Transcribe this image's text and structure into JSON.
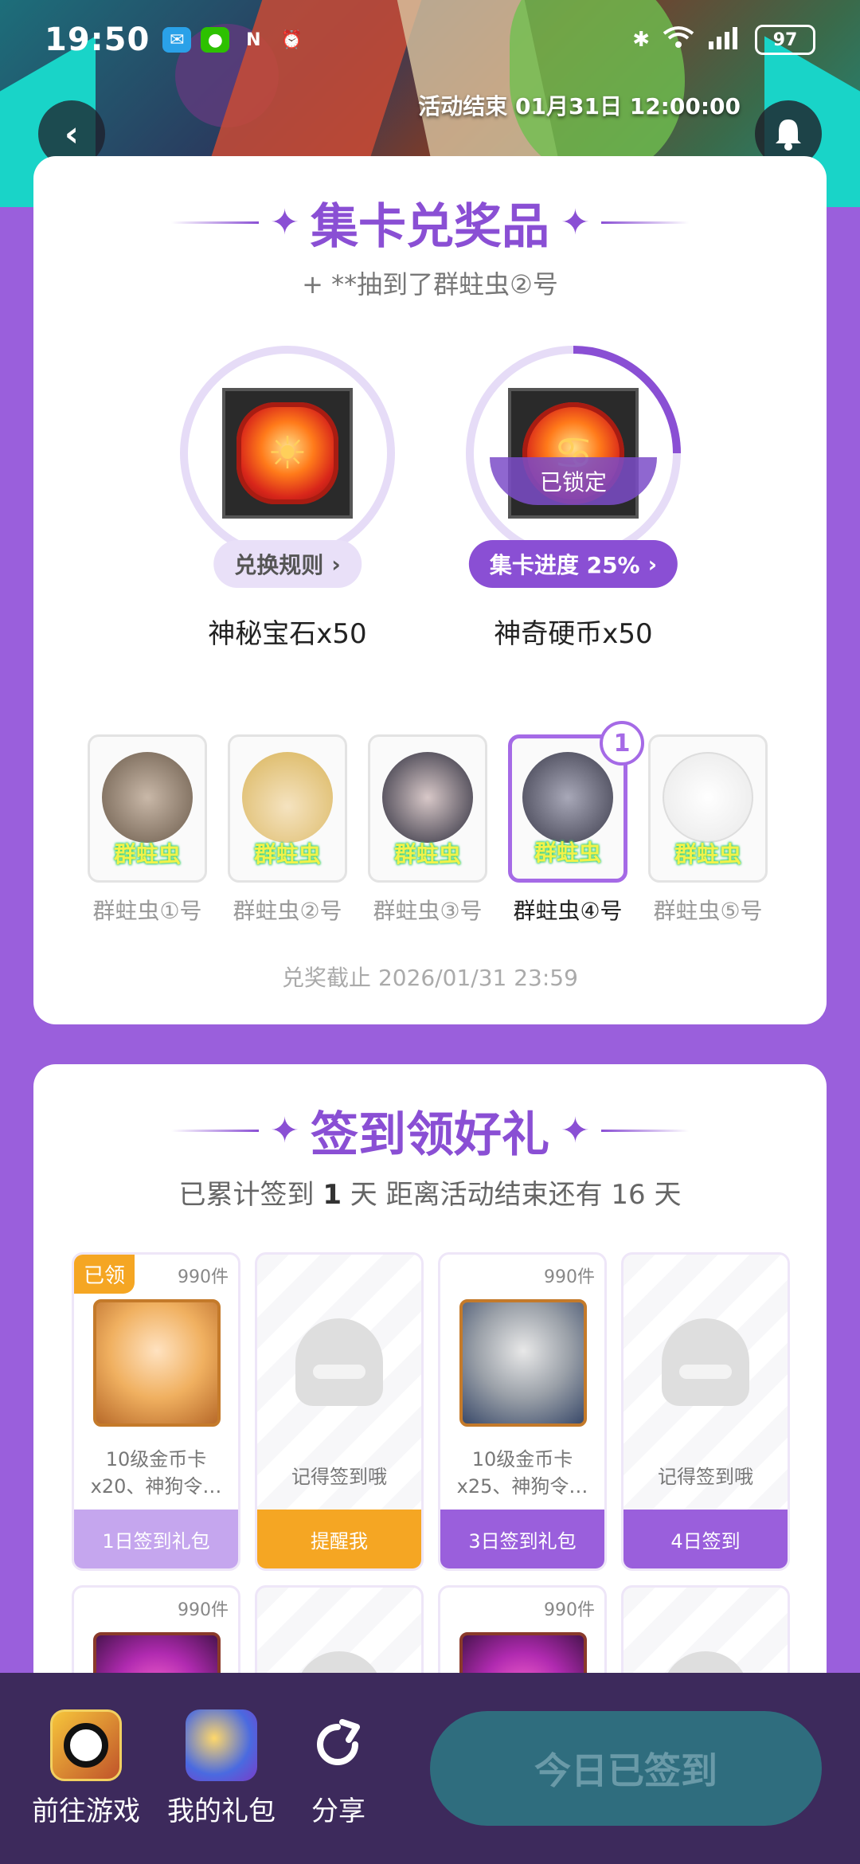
{
  "status_bar": {
    "time": "19:50",
    "battery": "97"
  },
  "header": {
    "end_time": "活动结束 01月31日 12:00:00"
  },
  "collect": {
    "title": "集卡兑奖品",
    "ticker": "+ **抽到了群蛀虫②号",
    "prizes": [
      {
        "name": "神秘宝石x50",
        "pill": "兑换规则"
      },
      {
        "name": "神奇硬币x50",
        "pill": "集卡进度 25%",
        "locked": "已锁定",
        "progress": 0.25
      }
    ],
    "cards": [
      {
        "tag": "群蛀虫",
        "label": "群蛀虫①号"
      },
      {
        "tag": "群蛀虫",
        "label": "群蛀虫②号"
      },
      {
        "tag": "群蛀虫",
        "label": "群蛀虫③号"
      },
      {
        "tag": "群蛀虫",
        "label": "群蛀虫④号",
        "count": "1"
      },
      {
        "tag": "群蛀虫",
        "label": "群蛀虫⑤号"
      }
    ],
    "deadline": "兑奖截止 2026/01/31 23:59"
  },
  "checkin": {
    "title": "签到领好礼",
    "info_prefix": "已累计签到",
    "days": "1",
    "info_suffix": "天  距离活动结束还有 16 天",
    "gifts": [
      {
        "count": "990件",
        "claimed": "已领",
        "desc": "10级金币卡 x20、神狗令…",
        "foot": "1日签到礼包"
      },
      {
        "desc": "记得签到哦",
        "foot": "提醒我"
      },
      {
        "count": "990件",
        "desc": "10级金币卡 x25、神狗令…",
        "foot": "3日签到礼包"
      },
      {
        "desc": "记得签到哦",
        "foot": "4日签到"
      },
      {
        "count": "990件"
      },
      {},
      {
        "count": "990件"
      },
      {}
    ]
  },
  "bottom_nav": {
    "items": [
      {
        "label": "前往游戏"
      },
      {
        "label": "我的礼包"
      },
      {
        "label": "分享"
      }
    ],
    "signed_button": "今日已签到"
  }
}
